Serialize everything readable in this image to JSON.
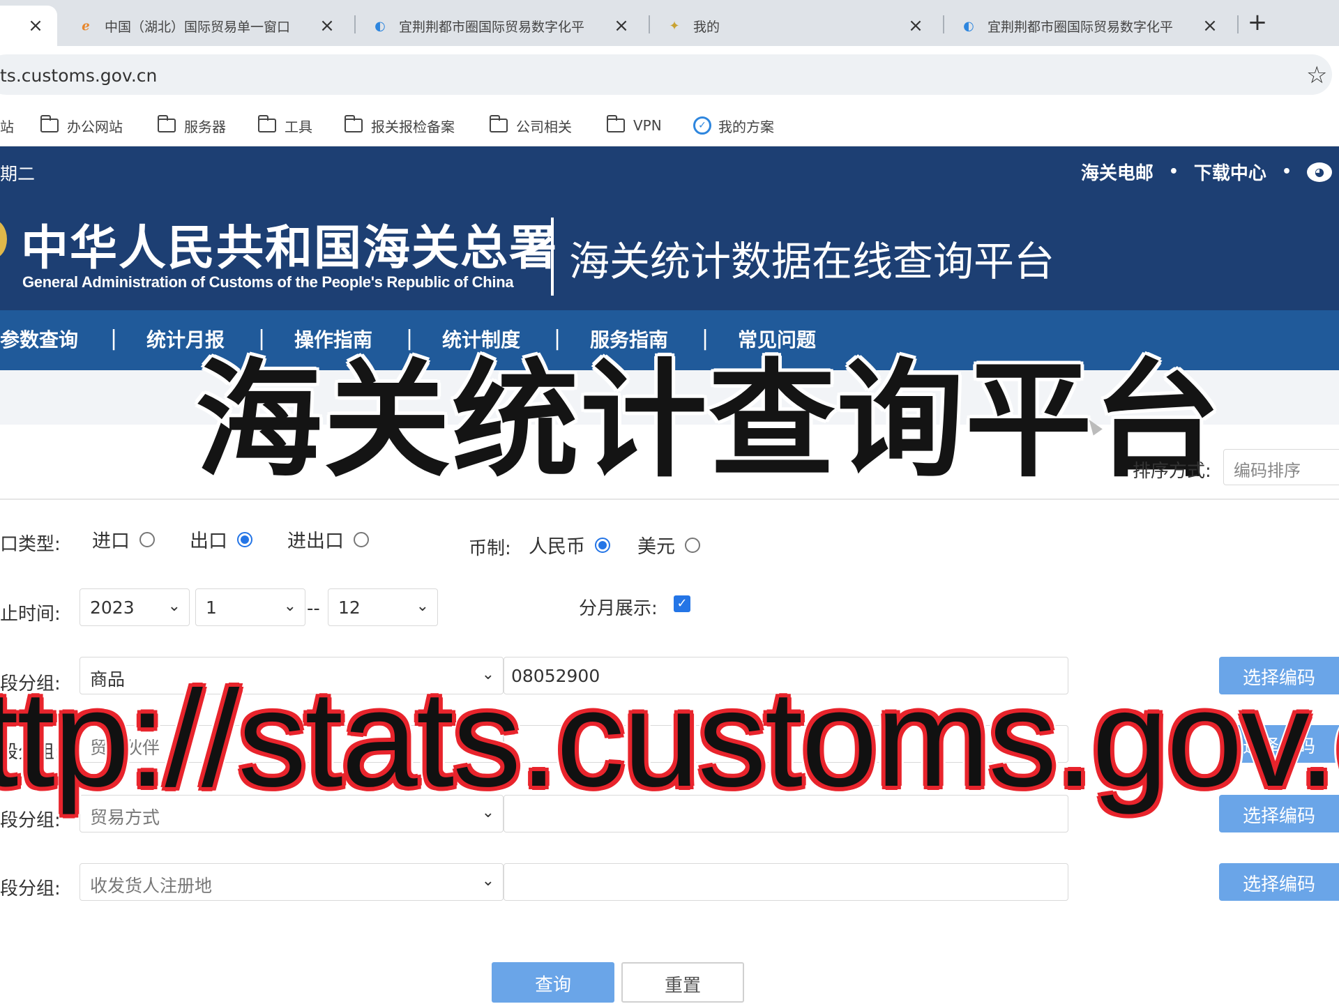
{
  "browser": {
    "tabs": [
      {
        "title": "",
        "active": true
      },
      {
        "title": "中国（湖北）国际贸易单一窗口",
        "favicon": "e-browser-icon"
      },
      {
        "title": "宜荆荆都市圈国际贸易数字化平",
        "favicon": "globe-icon"
      },
      {
        "title": "我的",
        "favicon": "app-icon"
      },
      {
        "title": "宜荆荆都市圈国际贸易数字化平",
        "favicon": "globe-icon"
      }
    ],
    "close_glyph": "×",
    "new_tab_glyph": "+",
    "url": "ts.customs.gov.cn",
    "star_glyph": "☆",
    "bookmarks": [
      {
        "label": "站",
        "icon": "folder-icon"
      },
      {
        "label": "办公网站",
        "icon": "folder-icon"
      },
      {
        "label": "服务器",
        "icon": "folder-icon"
      },
      {
        "label": "工具",
        "icon": "folder-icon"
      },
      {
        "label": "报关报检备案",
        "icon": "folder-icon"
      },
      {
        "label": "公司相关",
        "icon": "folder-icon"
      },
      {
        "label": "VPN",
        "icon": "folder-icon"
      },
      {
        "label": "我的方案",
        "icon": "shield-icon"
      }
    ]
  },
  "header": {
    "date": "期二",
    "links": [
      "海关电邮",
      "下载中心"
    ],
    "link_separator": "•",
    "org_cn": "中华人民共和国海关总署",
    "org_en": "General Administration of Customs of the People's Republic of China",
    "platform_title": "海关统计数据在线查询平台",
    "colors": {
      "header_bg": "#1d3f73",
      "nav_bg": "#205a9a",
      "accent": "#2475e6",
      "button": "#6aa5e8"
    }
  },
  "nav": {
    "items": [
      "参数查询",
      "统计月报",
      "操作指南",
      "统计制度",
      "服务指南",
      "常见问题"
    ],
    "separator": "|"
  },
  "overlay": {
    "title": "海关统计查询平台",
    "url_text": "ttp://stats.customs.gov.c"
  },
  "form": {
    "sort": {
      "label": "排序方式:",
      "value": "编码排序"
    },
    "trade_type": {
      "label": "口类型:",
      "options": [
        {
          "label": "进口",
          "selected": false
        },
        {
          "label": "出口",
          "selected": true
        },
        {
          "label": "进出口",
          "selected": false
        }
      ]
    },
    "currency": {
      "label": "币制:",
      "options": [
        {
          "label": "人民币",
          "selected": true
        },
        {
          "label": "美元",
          "selected": false
        }
      ]
    },
    "period": {
      "label": "止时间:",
      "year": "2023",
      "start_month": "1",
      "range_dash": "--",
      "end_month": "12"
    },
    "monthly_display": {
      "label": "分月展示:",
      "checked": true,
      "check_glyph": "✓"
    },
    "groups": [
      {
        "label": "段分组:",
        "select": "商品",
        "input": "08052900",
        "button": "选择编码"
      },
      {
        "label": "段分组:",
        "select": "贸易伙伴",
        "input": "",
        "button": "选择编码"
      },
      {
        "label": "段分组:",
        "select": "贸易方式",
        "input": "",
        "button": "选择编码"
      },
      {
        "label": "段分组:",
        "select": "收发货人注册地",
        "input": "",
        "button": "选择编码"
      }
    ],
    "chevron_glyph": "⌄",
    "query_button": "查询",
    "reset_button": "重置"
  }
}
